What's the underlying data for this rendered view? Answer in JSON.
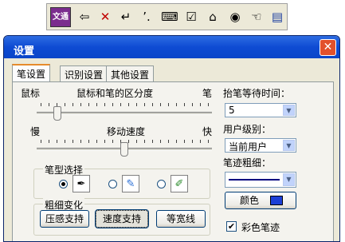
{
  "toolbar": {
    "logo_text": "文通",
    "icons": [
      "back-arrow-icon",
      "delete-x-icon",
      "enter-icon",
      "punctuation-icon",
      "keyboard-icon",
      "edit-form-icon",
      "eraser-icon",
      "eye-icon",
      "hand-pointer-icon",
      "document-icon"
    ]
  },
  "window": {
    "title": "设置",
    "close_label": "✕"
  },
  "tabs": [
    {
      "label": "笔设置"
    },
    {
      "label": "识别设置"
    },
    {
      "label": "其他设置"
    }
  ],
  "mouse_pen": {
    "left_label": "鼠标",
    "center_label": "鼠标和笔的区分度",
    "right_label": "笔",
    "level": 0.12
  },
  "speed": {
    "left_label": "慢",
    "center_label": "移动速度",
    "right_label": "快",
    "level": 0.5
  },
  "pen_type": {
    "title": "笔型选择",
    "selected_index": 0
  },
  "stroke_variation": {
    "title": "粗细变化",
    "buttons": [
      "压感支持",
      "速度支持",
      "等宽线"
    ],
    "active_index": 1
  },
  "right_panel": {
    "lift_wait_label": "抬笔等待时间：",
    "lift_wait_value": "5",
    "user_level_label": "用户级别：",
    "user_level_value": "当前用户",
    "pen_width_label": "笔迹粗细：",
    "color_button_label": "颜色",
    "color_swatch": "#1c3fd6",
    "color_pen_label": "彩色笔迹",
    "color_pen_checked": "✔"
  },
  "colors": {
    "title_bar": "#0e4bd3",
    "close_button": "#e2512c",
    "active_tab_accent": "#e68b2c"
  }
}
